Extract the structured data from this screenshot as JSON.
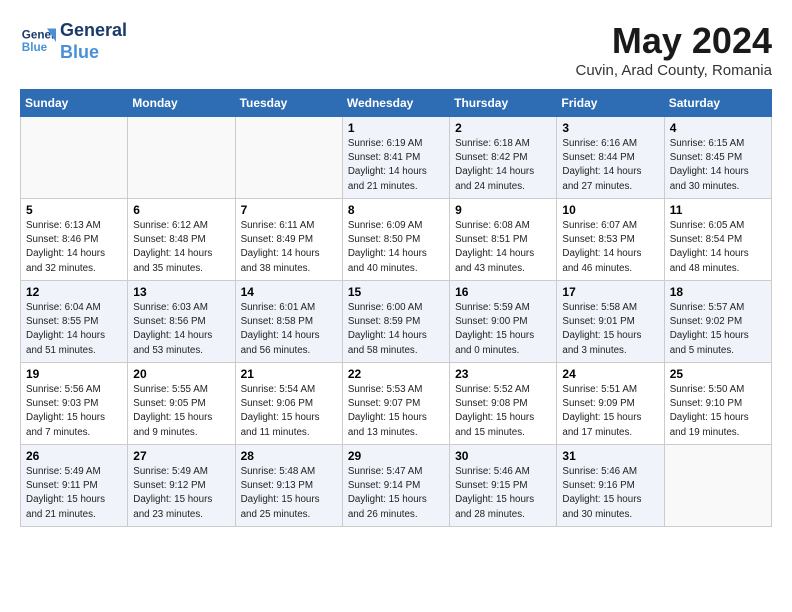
{
  "header": {
    "logo_line1": "General",
    "logo_line2": "Blue",
    "month": "May 2024",
    "location": "Cuvin, Arad County, Romania"
  },
  "days_of_week": [
    "Sunday",
    "Monday",
    "Tuesday",
    "Wednesday",
    "Thursday",
    "Friday",
    "Saturday"
  ],
  "weeks": [
    [
      {
        "day": null,
        "info": null
      },
      {
        "day": null,
        "info": null
      },
      {
        "day": null,
        "info": null
      },
      {
        "day": "1",
        "info": "Sunrise: 6:19 AM\nSunset: 8:41 PM\nDaylight: 14 hours\nand 21 minutes."
      },
      {
        "day": "2",
        "info": "Sunrise: 6:18 AM\nSunset: 8:42 PM\nDaylight: 14 hours\nand 24 minutes."
      },
      {
        "day": "3",
        "info": "Sunrise: 6:16 AM\nSunset: 8:44 PM\nDaylight: 14 hours\nand 27 minutes."
      },
      {
        "day": "4",
        "info": "Sunrise: 6:15 AM\nSunset: 8:45 PM\nDaylight: 14 hours\nand 30 minutes."
      }
    ],
    [
      {
        "day": "5",
        "info": "Sunrise: 6:13 AM\nSunset: 8:46 PM\nDaylight: 14 hours\nand 32 minutes."
      },
      {
        "day": "6",
        "info": "Sunrise: 6:12 AM\nSunset: 8:48 PM\nDaylight: 14 hours\nand 35 minutes."
      },
      {
        "day": "7",
        "info": "Sunrise: 6:11 AM\nSunset: 8:49 PM\nDaylight: 14 hours\nand 38 minutes."
      },
      {
        "day": "8",
        "info": "Sunrise: 6:09 AM\nSunset: 8:50 PM\nDaylight: 14 hours\nand 40 minutes."
      },
      {
        "day": "9",
        "info": "Sunrise: 6:08 AM\nSunset: 8:51 PM\nDaylight: 14 hours\nand 43 minutes."
      },
      {
        "day": "10",
        "info": "Sunrise: 6:07 AM\nSunset: 8:53 PM\nDaylight: 14 hours\nand 46 minutes."
      },
      {
        "day": "11",
        "info": "Sunrise: 6:05 AM\nSunset: 8:54 PM\nDaylight: 14 hours\nand 48 minutes."
      }
    ],
    [
      {
        "day": "12",
        "info": "Sunrise: 6:04 AM\nSunset: 8:55 PM\nDaylight: 14 hours\nand 51 minutes."
      },
      {
        "day": "13",
        "info": "Sunrise: 6:03 AM\nSunset: 8:56 PM\nDaylight: 14 hours\nand 53 minutes."
      },
      {
        "day": "14",
        "info": "Sunrise: 6:01 AM\nSunset: 8:58 PM\nDaylight: 14 hours\nand 56 minutes."
      },
      {
        "day": "15",
        "info": "Sunrise: 6:00 AM\nSunset: 8:59 PM\nDaylight: 14 hours\nand 58 minutes."
      },
      {
        "day": "16",
        "info": "Sunrise: 5:59 AM\nSunset: 9:00 PM\nDaylight: 15 hours\nand 0 minutes."
      },
      {
        "day": "17",
        "info": "Sunrise: 5:58 AM\nSunset: 9:01 PM\nDaylight: 15 hours\nand 3 minutes."
      },
      {
        "day": "18",
        "info": "Sunrise: 5:57 AM\nSunset: 9:02 PM\nDaylight: 15 hours\nand 5 minutes."
      }
    ],
    [
      {
        "day": "19",
        "info": "Sunrise: 5:56 AM\nSunset: 9:03 PM\nDaylight: 15 hours\nand 7 minutes."
      },
      {
        "day": "20",
        "info": "Sunrise: 5:55 AM\nSunset: 9:05 PM\nDaylight: 15 hours\nand 9 minutes."
      },
      {
        "day": "21",
        "info": "Sunrise: 5:54 AM\nSunset: 9:06 PM\nDaylight: 15 hours\nand 11 minutes."
      },
      {
        "day": "22",
        "info": "Sunrise: 5:53 AM\nSunset: 9:07 PM\nDaylight: 15 hours\nand 13 minutes."
      },
      {
        "day": "23",
        "info": "Sunrise: 5:52 AM\nSunset: 9:08 PM\nDaylight: 15 hours\nand 15 minutes."
      },
      {
        "day": "24",
        "info": "Sunrise: 5:51 AM\nSunset: 9:09 PM\nDaylight: 15 hours\nand 17 minutes."
      },
      {
        "day": "25",
        "info": "Sunrise: 5:50 AM\nSunset: 9:10 PM\nDaylight: 15 hours\nand 19 minutes."
      }
    ],
    [
      {
        "day": "26",
        "info": "Sunrise: 5:49 AM\nSunset: 9:11 PM\nDaylight: 15 hours\nand 21 minutes."
      },
      {
        "day": "27",
        "info": "Sunrise: 5:49 AM\nSunset: 9:12 PM\nDaylight: 15 hours\nand 23 minutes."
      },
      {
        "day": "28",
        "info": "Sunrise: 5:48 AM\nSunset: 9:13 PM\nDaylight: 15 hours\nand 25 minutes."
      },
      {
        "day": "29",
        "info": "Sunrise: 5:47 AM\nSunset: 9:14 PM\nDaylight: 15 hours\nand 26 minutes."
      },
      {
        "day": "30",
        "info": "Sunrise: 5:46 AM\nSunset: 9:15 PM\nDaylight: 15 hours\nand 28 minutes."
      },
      {
        "day": "31",
        "info": "Sunrise: 5:46 AM\nSunset: 9:16 PM\nDaylight: 15 hours\nand 30 minutes."
      },
      {
        "day": null,
        "info": null
      }
    ]
  ]
}
